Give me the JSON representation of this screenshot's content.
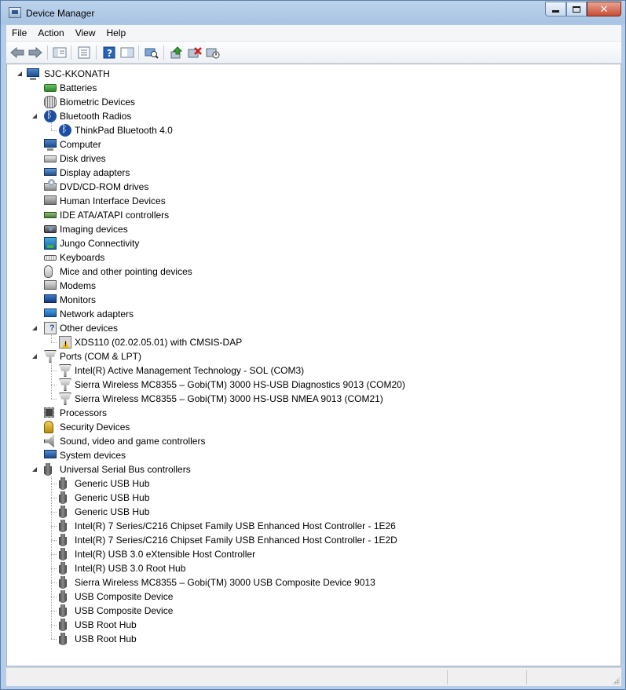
{
  "window": {
    "title": "Device Manager"
  },
  "caption": {
    "minimize": "_",
    "maximize": "□",
    "close": "✕"
  },
  "menu": [
    "File",
    "Action",
    "View",
    "Help"
  ],
  "toolbar_icons": [
    "back-icon",
    "forward-icon",
    "show-hide-console-tree-icon",
    "properties-icon",
    "help-icon",
    "view-icon",
    "scan-hardware-icon",
    "update-driver-icon",
    "uninstall-icon",
    "disable-device-icon"
  ],
  "tree": {
    "root": "SJC-KKONATH",
    "items": [
      {
        "label": "Batteries",
        "icon": "battery",
        "level": 1,
        "state": "closed"
      },
      {
        "label": "Biometric Devices",
        "icon": "bio",
        "level": 1,
        "state": "closed"
      },
      {
        "label": "Bluetooth Radios",
        "icon": "bt",
        "level": 1,
        "state": "open"
      },
      {
        "label": "ThinkPad Bluetooth 4.0",
        "icon": "bt",
        "level": 2
      },
      {
        "label": "Computer",
        "icon": "computer",
        "level": 1,
        "state": "closed"
      },
      {
        "label": "Disk drives",
        "icon": "disk",
        "level": 1,
        "state": "closed"
      },
      {
        "label": "Display adapters",
        "icon": "display",
        "level": 1,
        "state": "closed"
      },
      {
        "label": "DVD/CD-ROM drives",
        "icon": "dvd",
        "level": 1,
        "state": "closed"
      },
      {
        "label": "Human Interface Devices",
        "icon": "hid",
        "level": 1,
        "state": "closed"
      },
      {
        "label": "IDE ATA/ATAPI controllers",
        "icon": "ide",
        "level": 1,
        "state": "closed"
      },
      {
        "label": "Imaging devices",
        "icon": "imaging",
        "level": 1,
        "state": "closed"
      },
      {
        "label": "Jungo Connectivity",
        "icon": "jungo",
        "level": 1,
        "state": "closed"
      },
      {
        "label": "Keyboards",
        "icon": "keyboard",
        "level": 1,
        "state": "closed"
      },
      {
        "label": "Mice and other pointing devices",
        "icon": "mouse",
        "level": 1,
        "state": "closed"
      },
      {
        "label": "Modems",
        "icon": "modem",
        "level": 1,
        "state": "closed"
      },
      {
        "label": "Monitors",
        "icon": "monitor",
        "level": 1,
        "state": "closed"
      },
      {
        "label": "Network adapters",
        "icon": "network",
        "level": 1,
        "state": "closed"
      },
      {
        "label": "Other devices",
        "icon": "other",
        "level": 1,
        "state": "open"
      },
      {
        "label": "XDS110 (02.02.05.01) with CMSIS-DAP",
        "icon": "warn",
        "level": 2
      },
      {
        "label": "Ports (COM & LPT)",
        "icon": "port",
        "level": 1,
        "state": "open"
      },
      {
        "label": "Intel(R) Active Management Technology - SOL (COM3)",
        "icon": "port",
        "level": 2
      },
      {
        "label": "Sierra Wireless MC8355 – Gobi(TM) 3000 HS-USB Diagnostics 9013 (COM20)",
        "icon": "port",
        "level": 2
      },
      {
        "label": "Sierra Wireless MC8355 – Gobi(TM) 3000 HS-USB NMEA 9013 (COM21)",
        "icon": "port",
        "level": 2
      },
      {
        "label": "Processors",
        "icon": "proc",
        "level": 1,
        "state": "closed"
      },
      {
        "label": "Security Devices",
        "icon": "security",
        "level": 1,
        "state": "closed"
      },
      {
        "label": "Sound, video and game controllers",
        "icon": "sound",
        "level": 1,
        "state": "closed"
      },
      {
        "label": "System devices",
        "icon": "system",
        "level": 1,
        "state": "closed"
      },
      {
        "label": "Universal Serial Bus controllers",
        "icon": "usb",
        "level": 1,
        "state": "open"
      },
      {
        "label": "Generic USB Hub",
        "icon": "usb",
        "level": 2
      },
      {
        "label": "Generic USB Hub",
        "icon": "usb",
        "level": 2
      },
      {
        "label": "Generic USB Hub",
        "icon": "usb",
        "level": 2
      },
      {
        "label": "Intel(R) 7 Series/C216 Chipset Family USB Enhanced Host Controller - 1E26",
        "icon": "usb",
        "level": 2
      },
      {
        "label": "Intel(R) 7 Series/C216 Chipset Family USB Enhanced Host Controller - 1E2D",
        "icon": "usb",
        "level": 2
      },
      {
        "label": "Intel(R) USB 3.0 eXtensible Host Controller",
        "icon": "usb",
        "level": 2
      },
      {
        "label": "Intel(R) USB 3.0 Root Hub",
        "icon": "usb",
        "level": 2
      },
      {
        "label": "Sierra Wireless MC8355 – Gobi(TM) 3000 USB Composite Device 9013",
        "icon": "usb",
        "level": 2
      },
      {
        "label": "USB Composite Device",
        "icon": "usb",
        "level": 2
      },
      {
        "label": "USB Composite Device",
        "icon": "usb",
        "level": 2
      },
      {
        "label": "USB Root Hub",
        "icon": "usb",
        "level": 2
      },
      {
        "label": "USB Root Hub",
        "icon": "usb",
        "level": 2
      }
    ]
  }
}
